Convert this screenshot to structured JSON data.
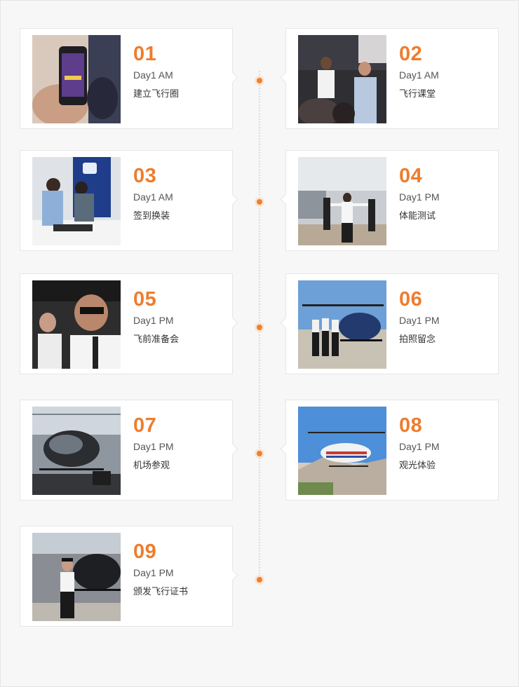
{
  "accent_color": "#ee7d2e",
  "items": [
    {
      "num": "01",
      "day": "Day1 AM",
      "title": "建立飞行圈",
      "image": "phone-mockup-photo"
    },
    {
      "num": "02",
      "day": "Day1 AM",
      "title": "飞行课堂",
      "image": "classroom-lecture-photo"
    },
    {
      "num": "03",
      "day": "Day1 AM",
      "title": "签到换装",
      "image": "check-in-desk-photo"
    },
    {
      "num": "04",
      "day": "Day1 PM",
      "title": "体能测试",
      "image": "fitness-test-photo"
    },
    {
      "num": "05",
      "day": "Day1 PM",
      "title": "飞前准备会",
      "image": "cockpit-pilots-photo"
    },
    {
      "num": "06",
      "day": "Day1 PM",
      "title": "拍照留念",
      "image": "helicopter-group-photo"
    },
    {
      "num": "07",
      "day": "Day1 PM",
      "title": "机场参观",
      "image": "hangar-helicopter-photo"
    },
    {
      "num": "08",
      "day": "Day1 PM",
      "title": "观光体验",
      "image": "sightseeing-helicopter-photo"
    },
    {
      "num": "09",
      "day": "Day1 PM",
      "title": "颁发飞行证书",
      "image": "pilot-certificate-photo"
    }
  ]
}
